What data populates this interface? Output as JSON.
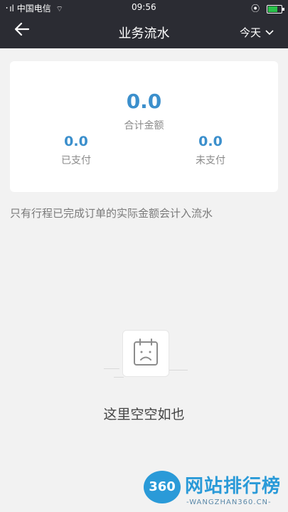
{
  "status_bar": {
    "signal": "᛫ıl",
    "carrier": "中国电信",
    "time": "09:56",
    "battery_color": "#29c24a"
  },
  "nav": {
    "title": "业务流水",
    "filter_label": "今天"
  },
  "summary": {
    "total_value": "0.0",
    "total_label": "合计金额",
    "paid_value": "0.0",
    "paid_label": "已支付",
    "unpaid_value": "0.0",
    "unpaid_label": "未支付"
  },
  "note": "只有行程已完成订单的实际金额会计入流水",
  "empty_state": {
    "icon": "sad-calendar-icon",
    "text": "这里空空如也"
  },
  "watermark": {
    "logo": "360",
    "title": "网站排行榜",
    "subtitle": "-WANGZHAN360.CN-"
  },
  "colors": {
    "topbar": "#2b2c33",
    "accent": "#3b8fcc",
    "background": "#f2f2f2"
  }
}
